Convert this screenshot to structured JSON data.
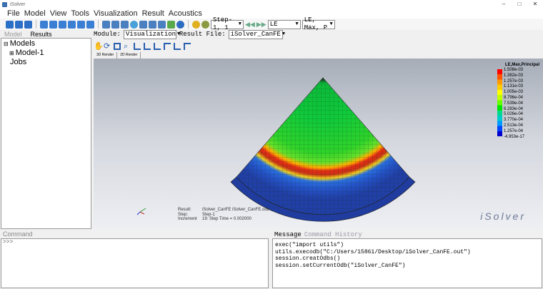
{
  "titlebar": {
    "title": "iSolver"
  },
  "menu": [
    "File",
    "Model",
    "View",
    "Tools",
    "Visualization",
    "Result",
    "Acoustics"
  ],
  "toolbar": {
    "step": "Step-1, 1",
    "field": "LE",
    "component": "LE, Max, P"
  },
  "left_tabs": {
    "model": "Model",
    "results": "Results"
  },
  "tree": {
    "models": "Models",
    "model1": "Model-1",
    "jobs": "Jobs"
  },
  "modulebar": {
    "module_label": "Module:",
    "module": "Visualization",
    "result_label": "Result File:",
    "result_file": "iSolver_CanFE"
  },
  "view_tabs": [
    "3D Render",
    "2D Render"
  ],
  "legend": {
    "title": "LE,Max,Principal",
    "values": [
      "1.508e-03",
      "1.382e-03",
      "1.257e-03",
      "1.131e-03",
      "1.005e-03",
      "8.796e-04",
      "7.539e-04",
      "6.283e-04",
      "5.026e-04",
      "3.770e-04",
      "2.513e-04",
      "1.257e-04",
      "-4.953e-17"
    ],
    "colors": [
      "#ff0000",
      "#ff5500",
      "#ff9900",
      "#ffcc00",
      "#ffff00",
      "#bfff00",
      "#66ff00",
      "#00e600",
      "#00d98c",
      "#00cccc",
      "#0099ff",
      "#0044ff",
      "#0000cc"
    ]
  },
  "info": {
    "result_key": "Result:",
    "result_val": "iSolver_CanFE   iSolver_CanFE.odb",
    "step_key": "Step:",
    "step_val": "Step-1",
    "inc_key": "Increment",
    "inc_val": "19: Step Time =   0.002000"
  },
  "brand": "iSolver",
  "command": {
    "label": "Command",
    "prompt": ">>>"
  },
  "message": {
    "tab_message": "Message",
    "tab_history": "Command History",
    "lines": "exec(\"import utils\")\nutils.execodb(\"C:/Users/15861/Desktop/iSolver_CanFE.out\")\nsession.creatOdbs()\nsession.setCurrentOdb(\"iSolver_CanFE\")"
  }
}
